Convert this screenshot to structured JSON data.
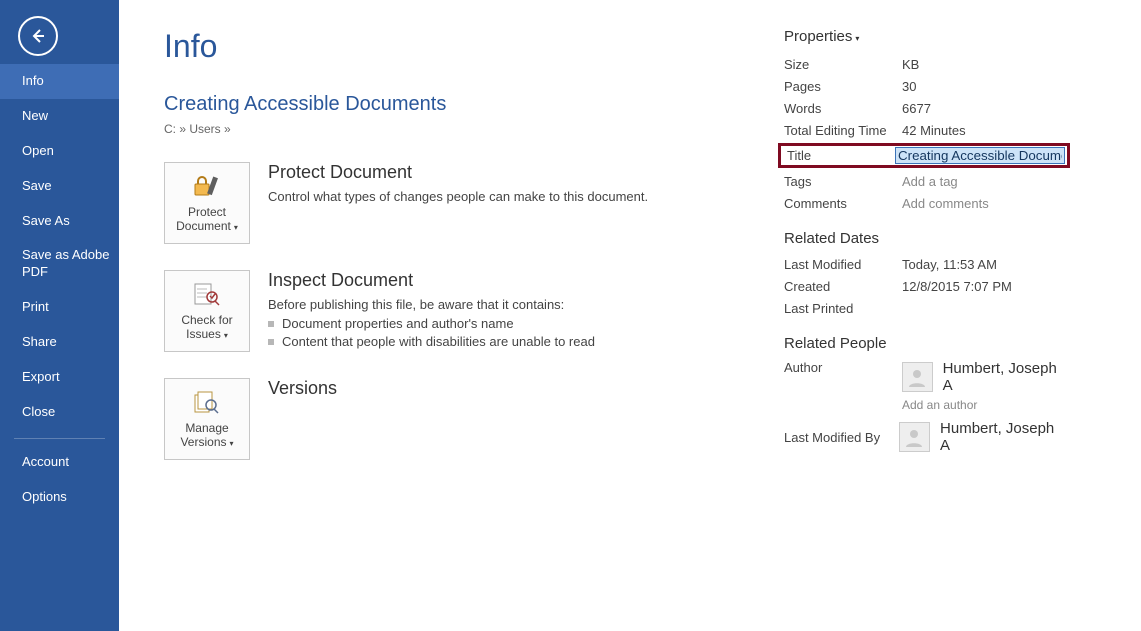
{
  "sidebar": {
    "items": [
      {
        "label": "Info",
        "active": true
      },
      {
        "label": "New"
      },
      {
        "label": "Open"
      },
      {
        "label": "Save"
      },
      {
        "label": "Save As"
      },
      {
        "label": "Save as Adobe PDF"
      },
      {
        "label": "Print"
      },
      {
        "label": "Share"
      },
      {
        "label": "Export"
      },
      {
        "label": "Close"
      }
    ],
    "bottom": [
      {
        "label": "Account"
      },
      {
        "label": "Options"
      }
    ]
  },
  "page": {
    "heading": "Info",
    "docTitle": "Creating Accessible Documents",
    "docPath": "C: » Users »"
  },
  "protect": {
    "btn": "Protect Document",
    "title": "Protect Document",
    "desc": "Control what types of changes people can make to this document."
  },
  "inspect": {
    "btn": "Check for Issues",
    "title": "Inspect Document",
    "desc": "Before publishing this file, be aware that it contains:",
    "items": [
      "Document properties and author's name",
      "Content that people with disabilities are unable to read"
    ]
  },
  "versions": {
    "btn": "Manage Versions",
    "title": "Versions"
  },
  "props": {
    "header": "Properties",
    "rows": {
      "size_l": "Size",
      "size_v": "KB",
      "pages_l": "Pages",
      "pages_v": "30",
      "words_l": "Words",
      "words_v": "6677",
      "time_l": "Total Editing Time",
      "time_v": "42 Minutes",
      "title_l": "Title",
      "title_v": "Creating Accessible Documents",
      "tags_l": "Tags",
      "tags_v": "Add a tag",
      "comments_l": "Comments",
      "comments_v": "Add comments"
    },
    "dates_h": "Related Dates",
    "dates": {
      "modified_l": "Last Modified",
      "modified_v": "Today, 11:53 AM",
      "created_l": "Created",
      "created_v": "12/8/2015 7:07 PM",
      "printed_l": "Last Printed",
      "printed_v": ""
    },
    "people_h": "Related People",
    "author_l": "Author",
    "author_v": "Humbert, Joseph A",
    "addauthor": "Add an author",
    "lastmod_l": "Last Modified By",
    "lastmod_v": "Humbert, Joseph A"
  }
}
